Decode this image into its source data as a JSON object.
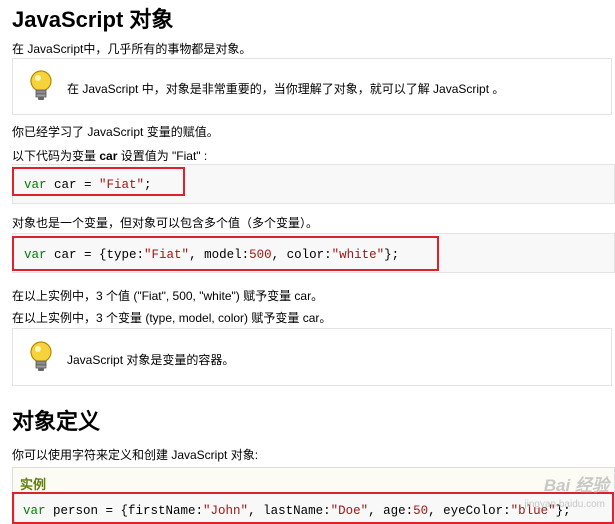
{
  "heading1": "JavaScript 对象",
  "intro": "在 JavaScript中，几乎所有的事物都是对象。",
  "tip1": "在 JavaScript 中，对象是非常重要的，当你理解了对象，就可以了解 JavaScript 。",
  "para_learned": "你已经学习了 JavaScript 变量的赋值。",
  "para_set_car": {
    "before": "以下代码为变量 ",
    "bold": "car",
    "after": " 设置值为 \"Fiat\" :"
  },
  "code1": {
    "kw": "var",
    "rest": " car = ",
    "str": "\"Fiat\"",
    "end": ";"
  },
  "para_object_var": "对象也是一个变量，但对象可以包含多个值（多个变量）。",
  "code2": {
    "kw": "var",
    "p1": " car = {type:",
    "s1": "\"Fiat\"",
    "p2": ", model:",
    "n1": "500",
    "p3": ", color:",
    "s2": "\"white\"",
    "end": "};"
  },
  "para_values": "在以上实例中，3 个值 (\"Fiat\", 500, \"white\") 赋予变量 car。",
  "para_variables": "在以上实例中，3 个变量 (type, model, color) 赋予变量 car。",
  "tip2": "JavaScript 对象是变量的容器。",
  "heading2": "对象定义",
  "para_define": "你可以使用字符来定义和创建 JavaScript 对象:",
  "example_label": "实例",
  "code3": {
    "kw": "var",
    "p1": " person = {firstName:",
    "s1": "\"John\"",
    "p2": ", lastName:",
    "s2": "\"Doe\"",
    "p3": ", age:",
    "n1": "50",
    "p4": ", eyeColor:",
    "s3": "\"blue\"",
    "end": "};"
  },
  "watermark": "Bai 经验",
  "watermark_sub": "jingyan.baidu.com",
  "colors": {
    "red_highlight": "#e0202a",
    "keyword": "#008000",
    "string": "#a31515",
    "example_label": "#617f10"
  },
  "icons": [
    "lightbulb-icon"
  ]
}
